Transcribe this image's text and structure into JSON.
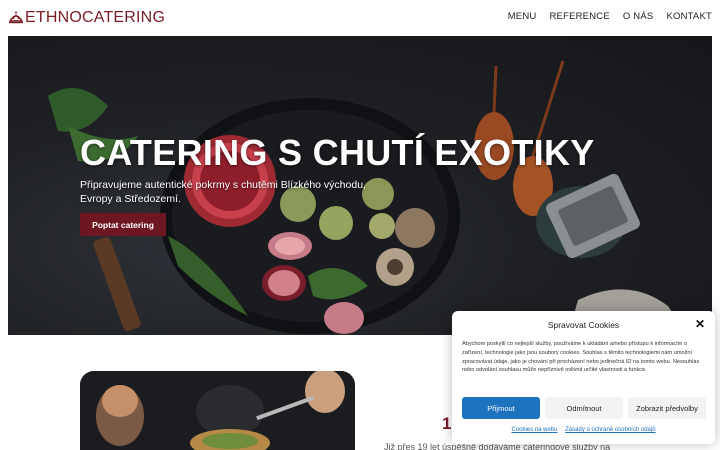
{
  "header": {
    "brand": "ETHNOCATERING",
    "nav": [
      {
        "label": "MENU"
      },
      {
        "label": "REFERENCE"
      },
      {
        "label": "O NÁS"
      },
      {
        "label": "KONTAKT"
      }
    ]
  },
  "hero": {
    "title": "CATERING S CHUTÍ EXOTIKY",
    "subtitle": "Připravujeme autentické pokrmy s chutěmi Blízkého východu, Evropy a Středozemí.",
    "cta_label": "Poptat catering"
  },
  "about": {
    "year": "19",
    "intro": "Již přes 19 let úspěšně dodáváme cateringové služby na"
  },
  "cookie": {
    "title": "Spravovat Cookies",
    "text": "Abychom poskytli co nejlepší služby, používáme k ukládání a/nebo přístupu k informacím o zařízení, technologie jako jsou soubory cookies. Souhlas s těmito technologiemi nám umožní zpracovávat údaje, jako je chování při procházení nebo jedinečná ID na tomto webu. Nesouhlas nebo odvolání souhlasu může nepříznivě ovlivnit určité vlastnosti a funkce.",
    "accept_label": "Přijmout",
    "deny_label": "Odmítnout",
    "prefs_label": "Zobrazit předvolby",
    "link_cookies": "Cookies na webu",
    "link_privacy": "Zásady o ochraně osobních údajů"
  },
  "colors": {
    "brand": "#7a1d24",
    "cta": "#6e1622",
    "accent_blue": "#1e73be"
  }
}
